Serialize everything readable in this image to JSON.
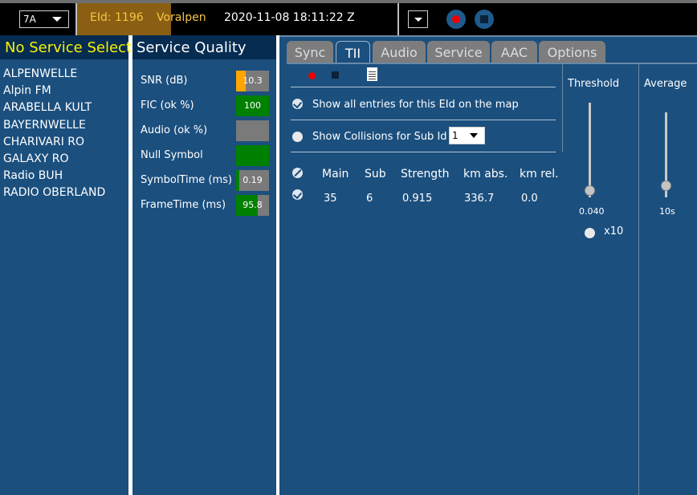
{
  "topbar": {
    "channel": "7A",
    "eid": "EId: 1196",
    "ensemble": "Voralpen",
    "datetime": "2020-11-08  18:11:22 Z"
  },
  "colors": {
    "accent": "#f5c542",
    "service_header": "#f7f200",
    "background": "#1b4f7e",
    "good": "#008000",
    "warn": "#ffa500",
    "neutral": "#7a7a7a"
  },
  "services": {
    "header": "No Service Selected",
    "items": [
      "ALPENWELLE",
      "Alpin FM",
      "ARABELLA KULT",
      "BAYERNWELLE",
      "CHARIVARI RO",
      "GALAXY RO",
      "Radio BUH",
      "RADIO OBERLAND"
    ]
  },
  "quality": {
    "header": "Service Quality",
    "rows": [
      {
        "label": "SNR (dB)",
        "value": "10.3",
        "fill_fraction": 0.3,
        "fill_color": "#ffa500"
      },
      {
        "label": "FIC (ok %)",
        "value": "100",
        "fill_fraction": 1.0,
        "fill_color": "#008000"
      },
      {
        "label": "Audio (ok %)",
        "value": "",
        "fill_fraction": 0.0,
        "fill_color": "#7a7a7a"
      },
      {
        "label": "Null Symbol",
        "value": "",
        "fill_fraction": 1.0,
        "fill_color": "#008000"
      },
      {
        "label": "SymbolTime (ms)",
        "value": "0.19",
        "fill_fraction": 0.1,
        "fill_color": "#008000"
      },
      {
        "label": "FrameTime (ms)",
        "value": "95.8",
        "fill_fraction": 0.65,
        "fill_color": "#008000"
      }
    ]
  },
  "tabs": [
    "Sync",
    "TII",
    "Audio",
    "Service",
    "AAC",
    "Options"
  ],
  "active_tab": "TII",
  "tii": {
    "show_all_label": "Show all entries for this EId on the map",
    "collisions_label": "Show Collisions for Sub Id",
    "sub_id": "1",
    "columns": [
      "Main",
      "Sub",
      "Strength",
      "km abs.",
      "km rel."
    ],
    "rows": [
      {
        "main": "35",
        "sub": "6",
        "strength": "0.915",
        "km_abs": "336.7",
        "km_rel": "0.0"
      }
    ],
    "threshold": {
      "title": "Threshold",
      "value": "0.040",
      "multiplier_label": "x10"
    },
    "average": {
      "title": "Average",
      "value": "10s"
    }
  }
}
